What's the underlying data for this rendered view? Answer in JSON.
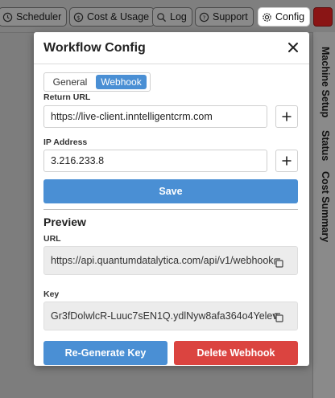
{
  "topbar": {
    "scheduler_label": "Scheduler",
    "cost_usage_label": "Cost & Usage",
    "log_label": "Log",
    "support_label": "Support",
    "config_label": "Config"
  },
  "side_tabs": {
    "machine_setup": "Machine Setup",
    "status": "Status",
    "cost_summary": "Cost Summary"
  },
  "modal": {
    "title": "Workflow Config",
    "tabs": {
      "general": "General",
      "webhook": "Webhook",
      "selected": "Webhook"
    },
    "return_url": {
      "label": "Return URL",
      "value": "https://live-client.inntelligentcrm.com"
    },
    "ip_address": {
      "label": "IP Address",
      "value": "3.216.233.8"
    },
    "save_label": "Save",
    "preview": {
      "title": "Preview",
      "url_label": "URL",
      "url_value": "https://api.quantumdatalytica.com/api/v1/webhook",
      "key_label": "Key",
      "key_value": "Gr3fDolwlcR-Luuc7sEN1Q.ydlNyw8afa364o4Yelev"
    },
    "regenerate_label": "Re-Generate Key",
    "delete_label": "Delete Webhook"
  },
  "colors": {
    "primary": "#4a8fd4",
    "danger": "#db4440",
    "close_button": "#8a1515"
  },
  "icons": {
    "scheduler": "clock-icon",
    "cost_usage": "dollar-icon",
    "log": "log-icon",
    "support": "question-icon",
    "config": "gear-icon",
    "close": "close-icon",
    "add": "plus-icon",
    "copy": "copy-icon"
  }
}
